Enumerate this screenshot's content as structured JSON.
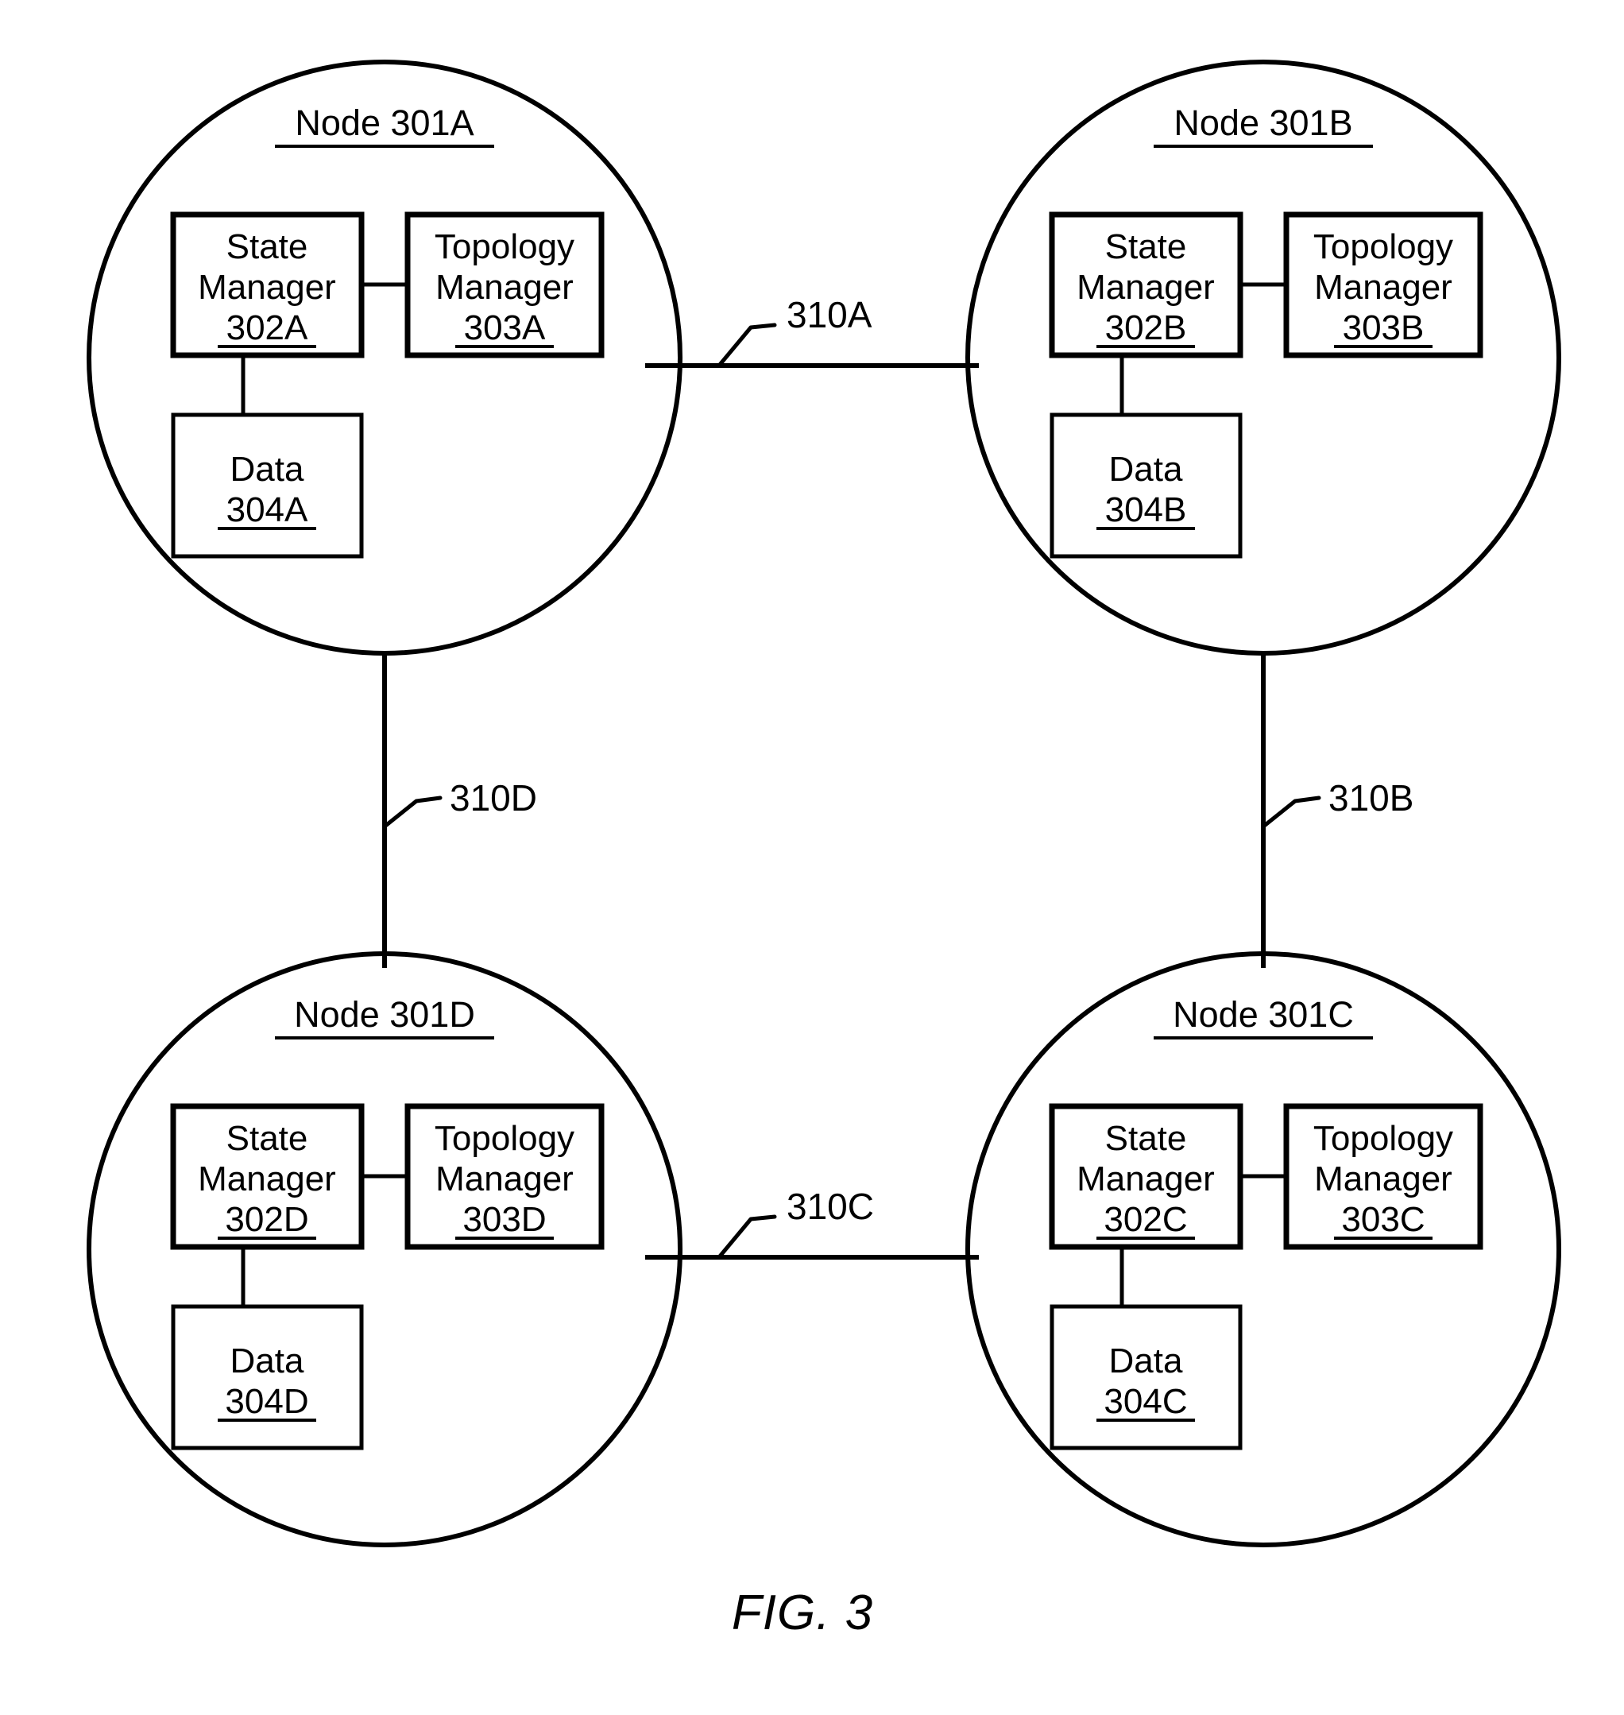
{
  "figure": {
    "caption": "FIG. 3",
    "title_prefix": "Node"
  },
  "nodes": [
    {
      "id": "301A",
      "title": "Node 301A",
      "position": "top-left",
      "components": [
        {
          "kind": "state-manager",
          "line1": "State",
          "line2": "Manager",
          "ref": "302A"
        },
        {
          "kind": "topology-manager",
          "line1": "Topology",
          "line2": "Manager",
          "ref": "303A"
        },
        {
          "kind": "data",
          "line1": "Data",
          "ref": "304A"
        }
      ]
    },
    {
      "id": "301B",
      "title": "Node 301B",
      "position": "top-right",
      "components": [
        {
          "kind": "state-manager",
          "line1": "State",
          "line2": "Manager",
          "ref": "302B"
        },
        {
          "kind": "topology-manager",
          "line1": "Topology",
          "line2": "Manager",
          "ref": "303B"
        },
        {
          "kind": "data",
          "line1": "Data",
          "ref": "304B"
        }
      ]
    },
    {
      "id": "301C",
      "title": "Node 301C",
      "position": "bottom-right",
      "components": [
        {
          "kind": "state-manager",
          "line1": "State",
          "line2": "Manager",
          "ref": "302C"
        },
        {
          "kind": "topology-manager",
          "line1": "Topology",
          "line2": "Manager",
          "ref": "303C"
        },
        {
          "kind": "data",
          "line1": "Data",
          "ref": "304C"
        }
      ]
    },
    {
      "id": "301D",
      "title": "Node 301D",
      "position": "bottom-left",
      "components": [
        {
          "kind": "state-manager",
          "line1": "State",
          "line2": "Manager",
          "ref": "302D"
        },
        {
          "kind": "topology-manager",
          "line1": "Topology",
          "line2": "Manager",
          "ref": "303D"
        },
        {
          "kind": "data",
          "line1": "Data",
          "ref": "304D"
        }
      ]
    }
  ],
  "links": [
    {
      "label": "310A",
      "from": "301A",
      "to": "301B",
      "orientation": "horizontal"
    },
    {
      "label": "310B",
      "from": "301B",
      "to": "301C",
      "orientation": "vertical"
    },
    {
      "label": "310C",
      "from": "301D",
      "to": "301C",
      "orientation": "horizontal"
    },
    {
      "label": "310D",
      "from": "301A",
      "to": "301D",
      "orientation": "vertical"
    }
  ],
  "style": {
    "stroke_color": "#000000",
    "background_color": "#ffffff"
  }
}
